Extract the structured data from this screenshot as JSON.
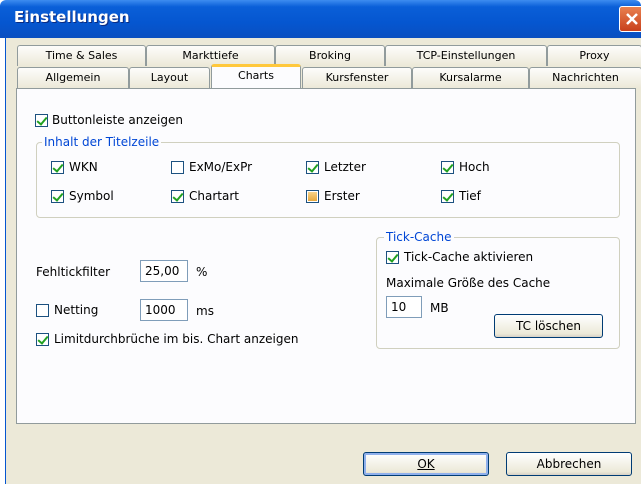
{
  "window": {
    "title": "Einstellungen"
  },
  "tabs_row1": [
    "Time & Sales",
    "Markttiefe",
    "Broking",
    "TCP-Einstellungen",
    "Proxy"
  ],
  "tabs_row2": [
    "Allgemein",
    "Layout",
    "Charts",
    "Kursfenster",
    "Kursalarme",
    "Nachrichten"
  ],
  "active_tab": "Charts",
  "charts": {
    "buttonleiste": {
      "label": "Buttonleiste anzeigen",
      "checked": true
    },
    "titelzeile": {
      "legend": "Inhalt der Titelzeile",
      "wkn": "WKN",
      "exmo": "ExMo/ExPr",
      "letzter": "Letzter",
      "hoch": "Hoch",
      "symbol": "Symbol",
      "chartart": "Chartart",
      "erster": "Erster",
      "tief": "Tief"
    },
    "fehltickfilter": {
      "label": "Fehltickfilter",
      "value": "25,00",
      "unit": "%"
    },
    "netting": {
      "label": "Netting",
      "value": "1000",
      "unit": "ms"
    },
    "limit": {
      "label": "Limitdurchbrüche im bis. Chart anzeigen"
    },
    "tickcache": {
      "legend": "Tick-Cache",
      "aktivieren": "Tick-Cache aktivieren",
      "max_label": "Maximale Größe des Cache",
      "size_value": "10",
      "size_unit": "MB",
      "delete_button": "TC löschen"
    }
  },
  "footer": {
    "ok": "OK",
    "cancel": "Abbrechen"
  }
}
